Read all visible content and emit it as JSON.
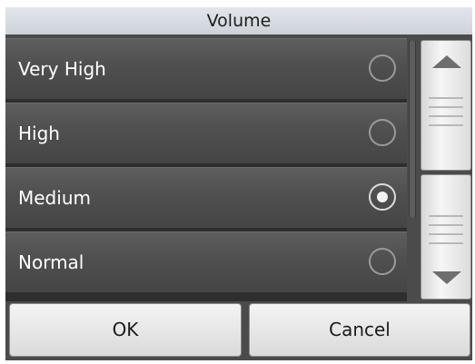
{
  "dialog": {
    "title": "Volume",
    "options": [
      {
        "label": "Very High",
        "selected": false
      },
      {
        "label": "High",
        "selected": false
      },
      {
        "label": "Medium",
        "selected": true
      },
      {
        "label": "Normal",
        "selected": false
      }
    ],
    "buttons": {
      "ok_label": "OK",
      "cancel_label": "Cancel"
    }
  },
  "icons": {
    "scroll_up": "triangle-up-icon",
    "scroll_down": "triangle-down-icon",
    "radio": "radio-button-icon"
  },
  "colors": {
    "title_bar": "#d5dae0",
    "list_background": "#4f4f4f",
    "button_face": "#e8e8e8",
    "text_light": "#ffffff",
    "text_dark": "#1b1b1b"
  }
}
